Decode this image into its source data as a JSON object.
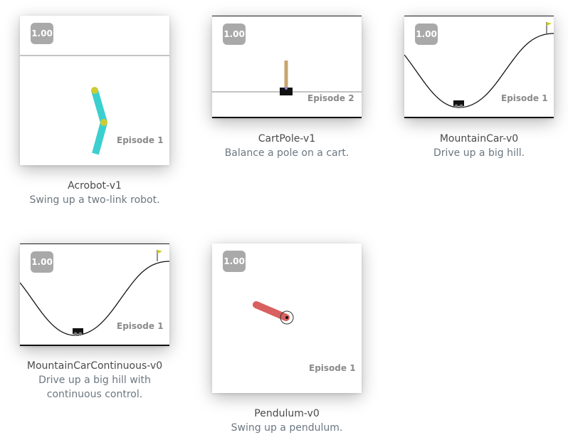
{
  "environments": [
    {
      "name": "Acrobot-v1",
      "description": "Swing up a two-link robot.",
      "score": "1.00",
      "episode": "Episode 1"
    },
    {
      "name": "CartPole-v1",
      "description": "Balance a pole on a cart.",
      "score": "1.00",
      "episode": "Episode 2"
    },
    {
      "name": "MountainCar-v0",
      "description": "Drive up a big hill.",
      "score": "1.00",
      "episode": "Episode 1"
    },
    {
      "name": "MountainCarContinuous-v0",
      "description": "Drive up a big hill with continuous control.",
      "score": "1.00",
      "episode": "Episode 1"
    },
    {
      "name": "Pendulum-v0",
      "description": "Swing up a pendulum.",
      "score": "1.00",
      "episode": "Episode 1"
    }
  ],
  "colors": {
    "acrobot_link": "#3ccfcf",
    "acrobot_joint": "#cccc33",
    "cart_pole": "#caa472",
    "pendulum_rod": "#d96060",
    "flag": "#cccc00"
  }
}
